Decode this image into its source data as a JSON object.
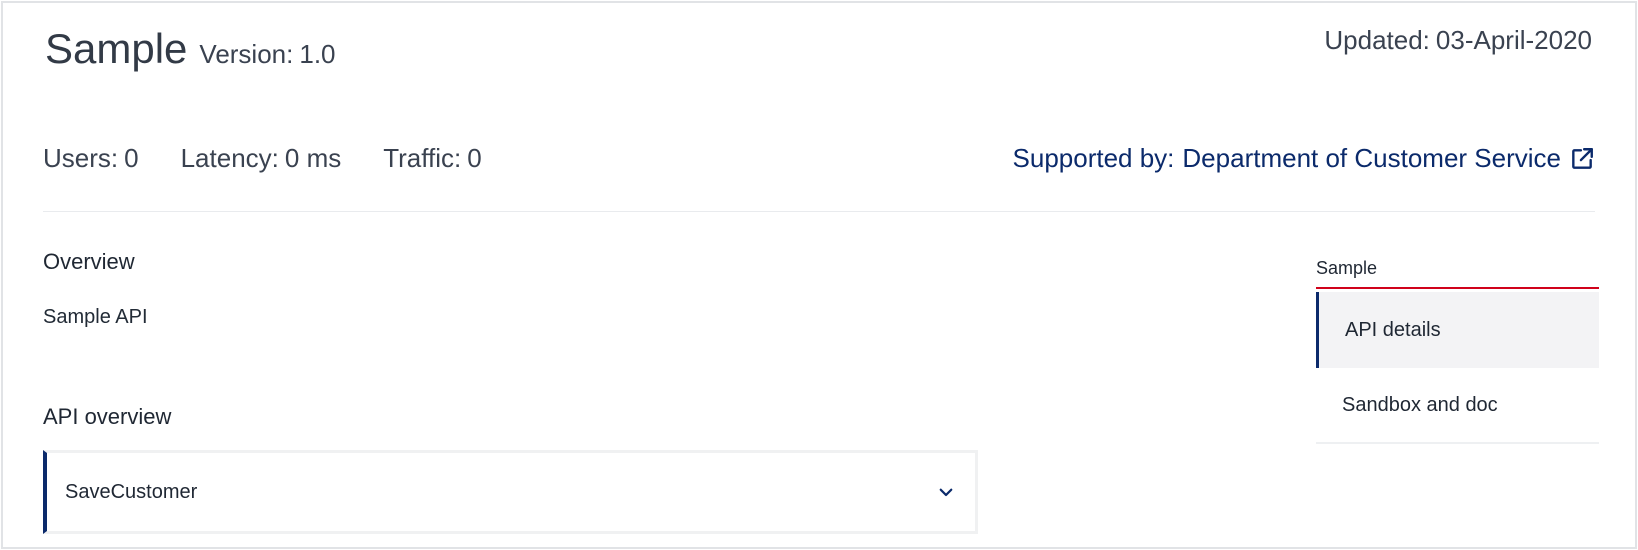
{
  "header": {
    "title": "Sample",
    "version_label": "Version:",
    "version_value": "1.0",
    "updated_label": "Updated:",
    "updated_value": "03-April-2020"
  },
  "stats": [
    {
      "label": "Users:",
      "value": "0"
    },
    {
      "label": "Latency:",
      "value": "0 ms"
    },
    {
      "label": "Traffic:",
      "value": "0"
    }
  ],
  "support": {
    "label": "Supported by:",
    "department": "Department of Customer Service",
    "icon": "external-link-icon"
  },
  "overview": {
    "heading": "Overview",
    "text": "Sample API"
  },
  "api_overview": {
    "heading": "API overview",
    "accordion_label": "SaveCustomer",
    "icon": "chevron-down-icon"
  },
  "side_nav": {
    "title": "Sample",
    "items": [
      {
        "label": "API details",
        "active": true
      },
      {
        "label": "Sandbox and doc",
        "active": false
      }
    ]
  },
  "colors": {
    "accent": "#0b2a6b",
    "active_underline": "#d0021b",
    "active_bg": "#f3f3f5"
  }
}
